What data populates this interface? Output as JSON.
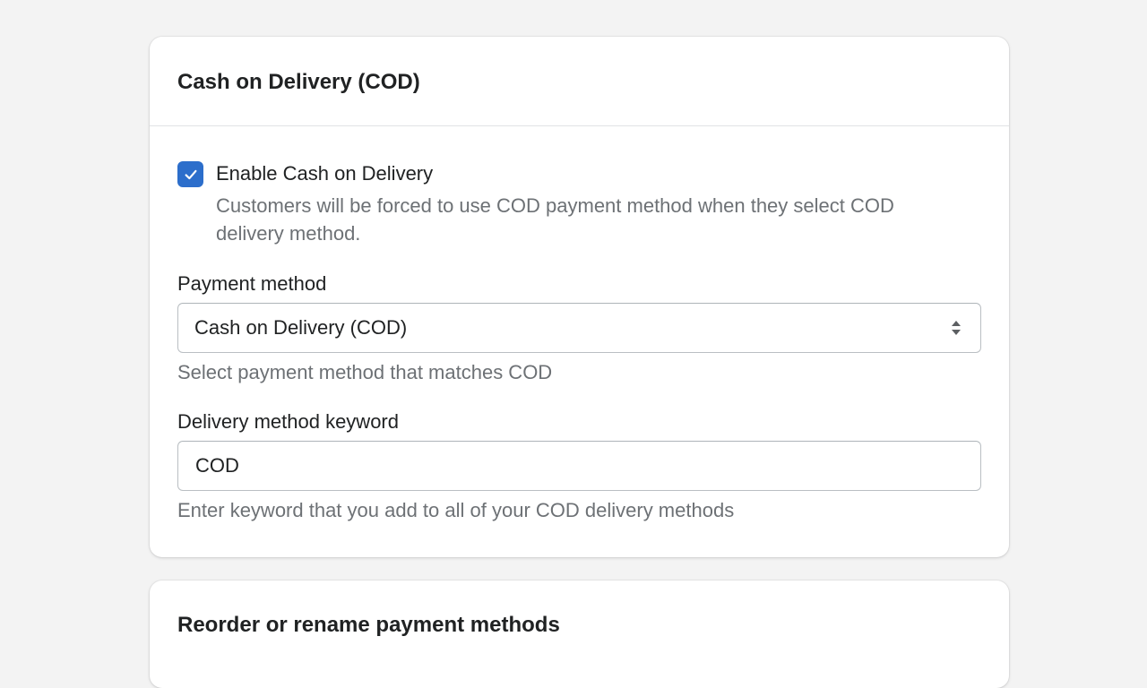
{
  "cod_card": {
    "title": "Cash on Delivery (COD)",
    "enable_checkbox": {
      "label": "Enable Cash on Delivery",
      "checked": true,
      "help": "Customers will be forced to use COD payment method when they select COD delivery method."
    },
    "payment_method": {
      "label": "Payment method",
      "selected": "Cash on Delivery (COD)",
      "help": "Select payment method that matches COD"
    },
    "delivery_keyword": {
      "label": "Delivery method keyword",
      "value": "COD",
      "help": "Enter keyword that you add to all of your COD delivery methods"
    }
  },
  "reorder_card": {
    "title": "Reorder or rename payment methods"
  },
  "colors": {
    "accent": "#2c6ecb",
    "page_background": "#f3f3f3",
    "card_background": "#ffffff",
    "text_primary": "#202223",
    "text_subdued": "#6d7175"
  },
  "icons": {
    "checkbox": "checkmark-icon",
    "select": "select-arrows-icon"
  }
}
